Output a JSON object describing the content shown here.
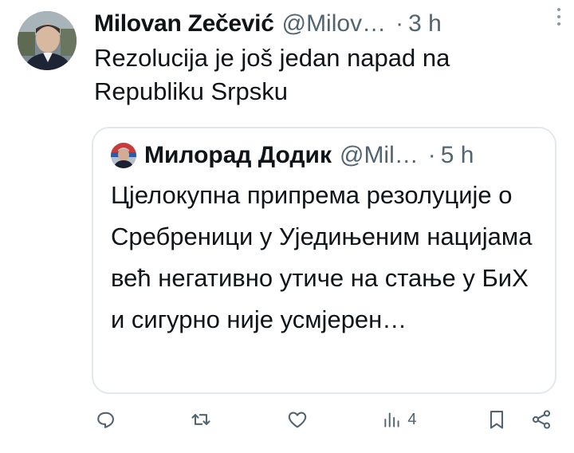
{
  "tweet": {
    "author_name": "Milovan Zečević",
    "author_handle": "@Milov…",
    "separator": "·",
    "time": "3 h",
    "text": "Rezolucija je još jedan napad na Republiku Srpsku"
  },
  "quoted_tweet": {
    "author_name": "Милорад Додик",
    "author_handle": "@Mil…",
    "separator": "·",
    "time": "5 h",
    "text": "Цјелокупна припрема резолуције о Сребреници у Уједињеним нацијама већ негативно утиче на стање у БиХ и сигурно није усмјерен…"
  },
  "actions": {
    "reply_count": "",
    "retweet_count": "",
    "like_count": "",
    "views_count": "4"
  },
  "icons": {
    "more": "more-dots-icon",
    "reply": "reply-icon",
    "retweet": "retweet-icon",
    "like": "heart-icon",
    "views": "views-icon",
    "bookmark": "bookmark-icon",
    "share": "share-icon"
  },
  "colors": {
    "text": "#0f1419",
    "secondary": "#536471",
    "border": "#e3e8ec",
    "background": "#ffffff"
  }
}
